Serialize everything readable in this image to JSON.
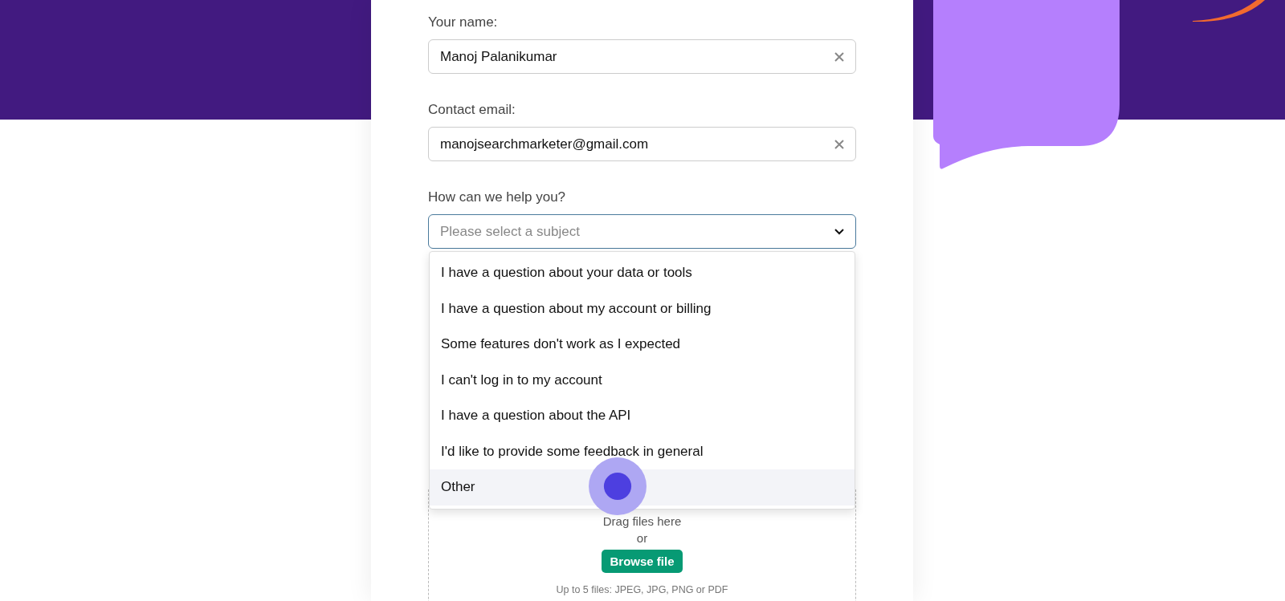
{
  "form": {
    "fields": [
      {
        "label": "Your name:",
        "value": "Manoj Palanikumar",
        "clearable": true
      },
      {
        "label": "Contact email:",
        "value": "manojsearchmarketer@gmail.com",
        "clearable": true
      }
    ],
    "subject": {
      "label": "How can we help you?",
      "placeholder": "Please select a subject",
      "expanded": true,
      "options": [
        {
          "label": "I have a question about your data or tools",
          "selected": false
        },
        {
          "label": "I have a question about my account or billing",
          "selected": false
        },
        {
          "label": "Some features don't work as I expected",
          "selected": false
        },
        {
          "label": "I can't log in to my account",
          "selected": false
        },
        {
          "label": "I have a question about the API",
          "selected": false
        },
        {
          "label": "I'd like to provide some feedback in general",
          "selected": false
        },
        {
          "label": "Other",
          "selected": true
        }
      ]
    },
    "upload": {
      "hint": "Drag files here",
      "separator": "or",
      "button": "Browse file",
      "note": "Up to 5 files: JPEG, JPG, PNG or PDF"
    }
  }
}
